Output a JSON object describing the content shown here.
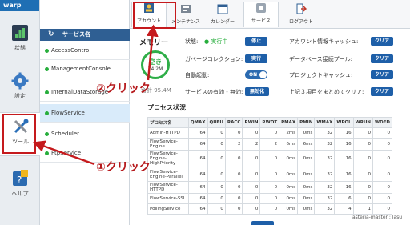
{
  "app": {
    "logo": "warp"
  },
  "rail": [
    {
      "label": "状態",
      "icon": "bar-chart-icon"
    },
    {
      "label": "設定",
      "icon": "gear-icon"
    },
    {
      "label": "ツール",
      "icon": "tools-icon",
      "active": true
    },
    {
      "label": "ヘルプ",
      "icon": "help-icon"
    }
  ],
  "services": {
    "header": "サービス名",
    "items": [
      {
        "name": "AccessControl"
      },
      {
        "name": "ManagementConsole"
      },
      {
        "name": "InternalDataStorage"
      },
      {
        "name": "FlowService",
        "selected": true
      },
      {
        "name": "Scheduler"
      },
      {
        "name": "FtpService"
      }
    ]
  },
  "toolbar": [
    {
      "label": "アカウント",
      "icon": "account-icon",
      "active": true
    },
    {
      "label": "メンテナンス",
      "icon": "maintenance-icon"
    },
    {
      "label": "カレンダー",
      "icon": "calendar-icon"
    },
    {
      "label": "サービス",
      "icon": "service-icon"
    },
    {
      "label": "ログアウト",
      "icon": "logout-icon"
    }
  ],
  "memory": {
    "title": "メモリー",
    "gauge_label": "空き",
    "gauge_value": "74.2M",
    "total_label": "合計 95.4M",
    "used_fraction": 0.22,
    "status_label": "状態:",
    "status_value": "● 実行中",
    "stop_btn": "停止",
    "gc_label": "ガベージコレクション:",
    "gc_btn": "実行",
    "autostart_label": "自動起動:",
    "autostart_value": "ON",
    "enable_label": "サービスの有効・無効:",
    "enable_btn": "無効化"
  },
  "caches": {
    "account_label": "アカウント情報キャッシュ:",
    "db_label": "データベース接続プール:",
    "project_label": "プロジェクトキャッシュ:",
    "all_label": "上記３項目をまとめてクリア:",
    "clear_btn": "クリア"
  },
  "process": {
    "title": "プロセス状況",
    "columns": [
      "プロセス名",
      "QMAX",
      "QUEU",
      "RACC",
      "RWIN",
      "RWOT",
      "PMAX",
      "PMIN",
      "WMAX",
      "WPOL",
      "WRUN",
      "WDED"
    ],
    "rows": [
      [
        "Admin-HTTPD",
        "64",
        "0",
        "0",
        "0",
        "0",
        "2ms",
        "0ms",
        "32",
        "16",
        "0",
        "0"
      ],
      [
        "FlowService-Engine",
        "64",
        "0",
        "2",
        "2",
        "2",
        "6ms",
        "6ms",
        "32",
        "16",
        "0",
        "0"
      ],
      [
        "FlowService-Engine-HighPriority",
        "64",
        "0",
        "0",
        "0",
        "0",
        "0ms",
        "0ms",
        "32",
        "16",
        "0",
        "0"
      ],
      [
        "FlowService-Engine-Parallel",
        "64",
        "0",
        "0",
        "0",
        "0",
        "0ms",
        "0ms",
        "32",
        "16",
        "0",
        "0"
      ],
      [
        "FlowService-HTTPD",
        "64",
        "0",
        "0",
        "0",
        "0",
        "0ms",
        "0ms",
        "32",
        "16",
        "0",
        "0"
      ],
      [
        "FlowService-SSL",
        "64",
        "0",
        "0",
        "0",
        "0",
        "0ms",
        "0ms",
        "32",
        "6",
        "0",
        "0"
      ],
      [
        "PollingService",
        "64",
        "0",
        "0",
        "0",
        "0",
        "0ms",
        "0ms",
        "32",
        "4",
        "1",
        "0"
      ]
    ]
  },
  "footer": {
    "server": "asteria-master : lasu"
  },
  "annotations": {
    "step1": "①クリック",
    "step2": "②クリック",
    "color": "#c51a1d"
  }
}
